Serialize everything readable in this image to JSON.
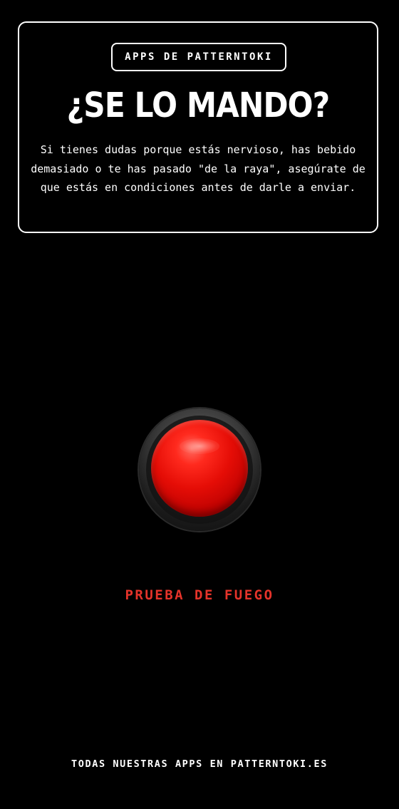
{
  "header": {
    "badge_label": "APPS DE PATTERNTOKI",
    "title": "¿SE LO MANDO?",
    "description": "Si tienes dudas porque estás nervioso, has bebido demasiado o te has pasado \"de la raya\", asegúrate de que estás en condiciones antes de darle a enviar."
  },
  "main": {
    "button_icon": "red-push-button-icon",
    "button_label": "PRUEBA DE FUEGO"
  },
  "footer": {
    "text_prefix": "TODAS NUESTRAS APPS EN ",
    "link_label": "PATTERNTOKI.ES"
  },
  "colors": {
    "background": "#000000",
    "foreground": "#ffffff",
    "accent": "#e5332a",
    "button_red": "#e50d06"
  }
}
